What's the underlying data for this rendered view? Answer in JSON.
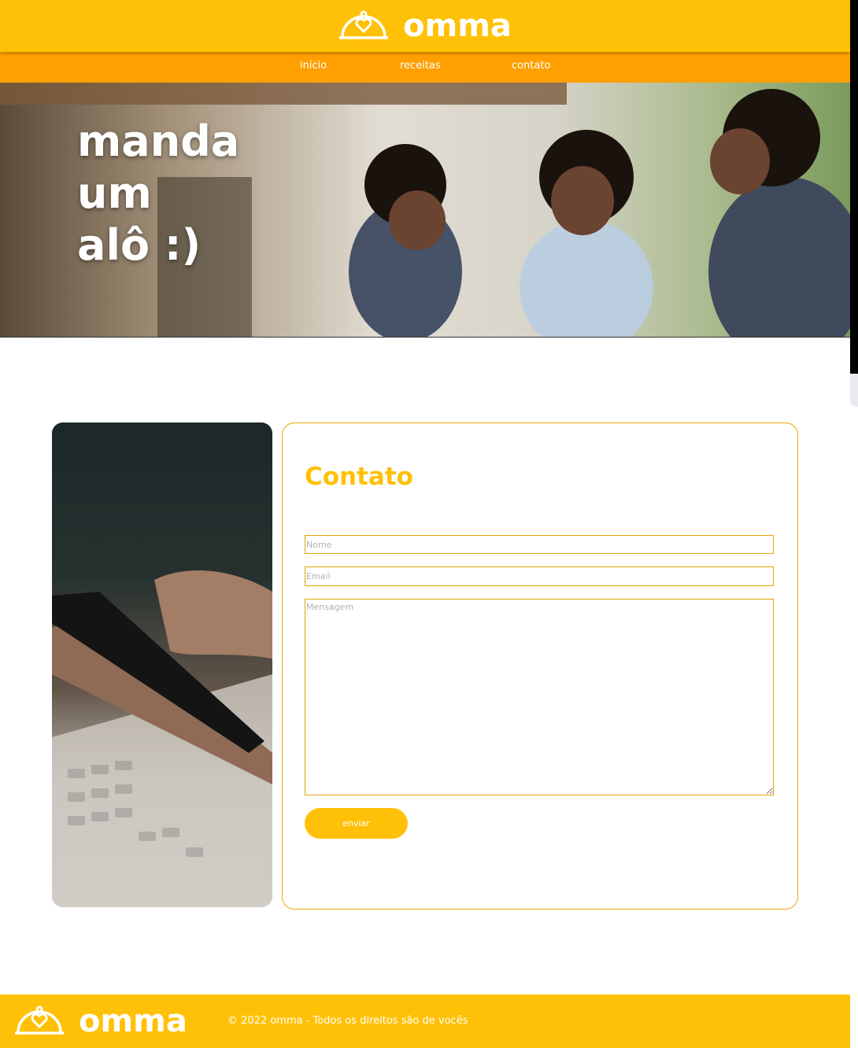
{
  "brand": {
    "name": "omma",
    "primary_color": "#ffc107",
    "nav_color": "#ff9f00",
    "logo_icon": "cloche-heart-icon"
  },
  "nav": {
    "items": [
      {
        "label": "início"
      },
      {
        "label": "receitas"
      },
      {
        "label": "contato"
      }
    ]
  },
  "hero": {
    "lines": [
      "manda",
      "um",
      "alô :)"
    ],
    "image": "family-cooking-photo"
  },
  "contact": {
    "side_image": "hands-phone-laptop-photo",
    "title": "Contato",
    "fields": {
      "name_placeholder": "Nome",
      "email_placeholder": "Email",
      "message_placeholder": "Mensagem"
    },
    "submit_label": "enviar"
  },
  "footer": {
    "brand": "omma",
    "copyright": "© 2022 omma - Todos os direitos são de vocês"
  }
}
